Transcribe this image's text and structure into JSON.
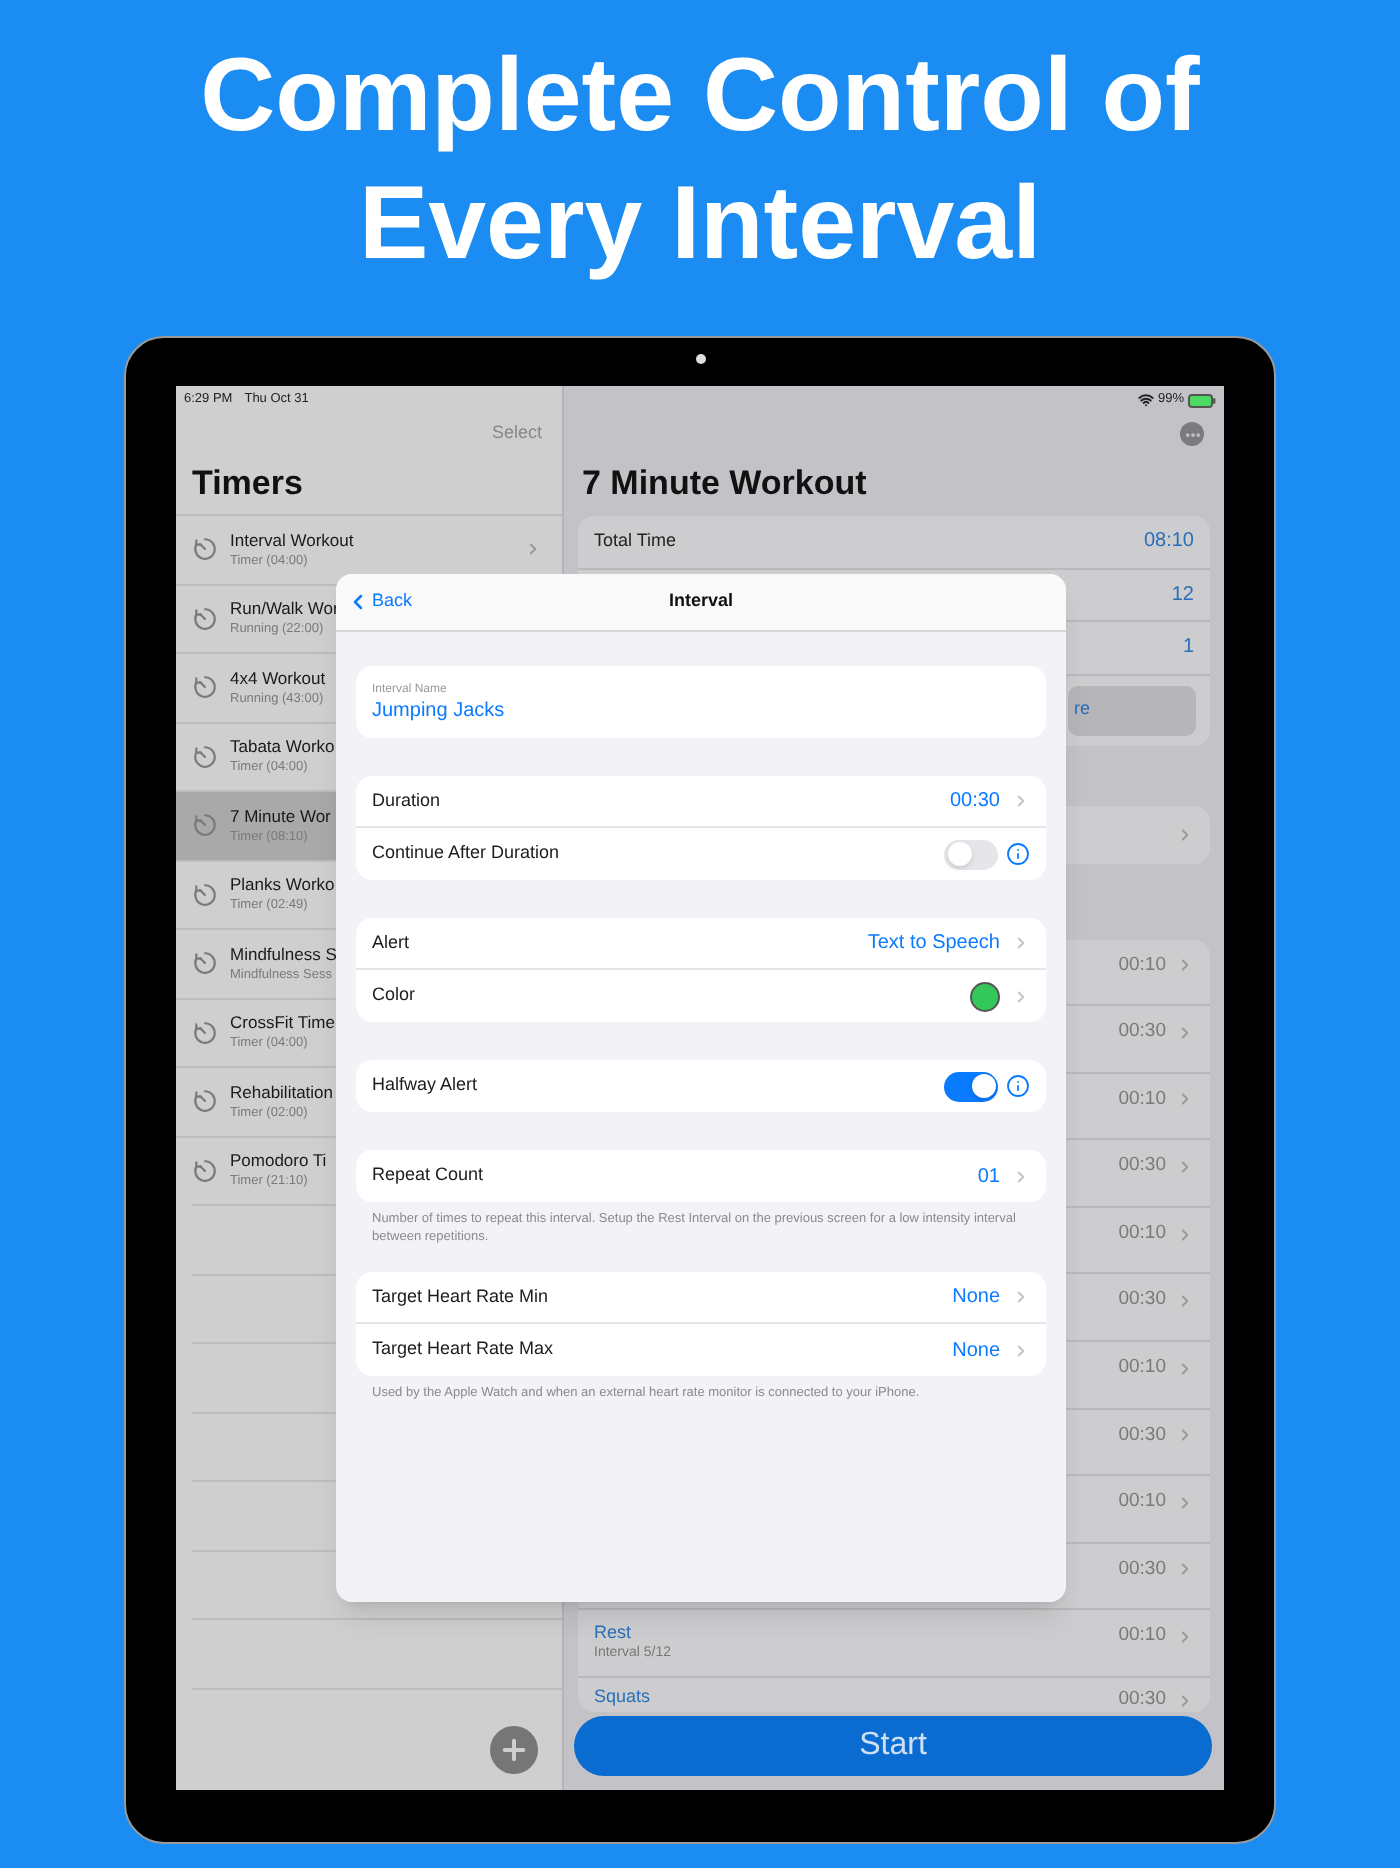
{
  "headline_lines": [
    "Complete Control of",
    "Every Interval"
  ],
  "status_bar": {
    "time": "6:29 PM",
    "date": "Thu Oct 31",
    "battery": "99%"
  },
  "sidebar": {
    "action": "Select",
    "title": "Timers",
    "items": [
      {
        "title": "Interval Workout",
        "subtitle": "Timer (04:00)",
        "selected": false,
        "disclosure": true
      },
      {
        "title": "Run/Walk Wor",
        "subtitle": "Running (22:00)",
        "selected": false
      },
      {
        "title": "4x4 Workout",
        "subtitle": "Running (43:00)",
        "selected": false
      },
      {
        "title": "Tabata Worko",
        "subtitle": "Timer (04:00)",
        "selected": false
      },
      {
        "title": "7 Minute Wor",
        "subtitle": "Timer (08:10)",
        "selected": true
      },
      {
        "title": "Planks Worko",
        "subtitle": "Timer (02:49)",
        "selected": false
      },
      {
        "title": "Mindfulness S",
        "subtitle": "Mindfulness Sess",
        "selected": false
      },
      {
        "title": "CrossFit Time",
        "subtitle": "Timer (04:00)",
        "selected": false
      },
      {
        "title": "Rehabilitation",
        "subtitle": "Timer (02:00)",
        "selected": false
      },
      {
        "title": "Pomodoro Ti",
        "subtitle": "Timer (21:10)",
        "selected": false
      }
    ]
  },
  "detail": {
    "title": "7 Minute Workout",
    "summary": [
      {
        "label": "Total Time",
        "value": "08:10"
      },
      {
        "value": "12"
      },
      {
        "value": "1"
      }
    ],
    "summary_button": "re",
    "intervals": [
      {
        "value": "00:10"
      },
      {
        "value": "00:30"
      },
      {
        "value": "00:10"
      },
      {
        "value": "00:30"
      },
      {
        "value": "00:10"
      },
      {
        "value": "00:30"
      },
      {
        "value": "00:10"
      },
      {
        "value": "00:30"
      },
      {
        "value": "00:10"
      },
      {
        "value": "00:30"
      },
      {
        "title": "Rest",
        "subtitle": "Interval 5/12",
        "value": "00:10"
      },
      {
        "title": "Squats",
        "value": "00:30"
      }
    ],
    "start_button": "Start"
  },
  "modal": {
    "back": "Back",
    "title": "Interval",
    "name_field": {
      "label": "Interval Name",
      "value": "Jumping Jacks"
    },
    "groups": [
      {
        "rows": [
          {
            "kind": "value",
            "label": "Duration",
            "value": "00:30"
          },
          {
            "kind": "toggle",
            "label": "Continue After Duration",
            "on": false
          }
        ]
      },
      {
        "rows": [
          {
            "kind": "value",
            "label": "Alert",
            "value": "Text to Speech"
          },
          {
            "kind": "color",
            "label": "Color",
            "color": "#34c759"
          }
        ]
      },
      {
        "rows": [
          {
            "kind": "toggle",
            "label": "Halfway Alert",
            "on": true
          }
        ]
      },
      {
        "rows": [
          {
            "kind": "value",
            "label": "Repeat Count",
            "value": "01"
          }
        ],
        "footer": "Number of times to repeat this interval. Setup the Rest Interval on the previous screen for a low intensity interval between repetitions."
      },
      {
        "rows": [
          {
            "kind": "value",
            "label": "Target Heart Rate Min",
            "value": "None"
          },
          {
            "kind": "value",
            "label": "Target Heart Rate Max",
            "value": "None"
          }
        ],
        "footer": "Used by the Apple Watch and when an external heart rate monitor is connected to your iPhone."
      }
    ]
  }
}
